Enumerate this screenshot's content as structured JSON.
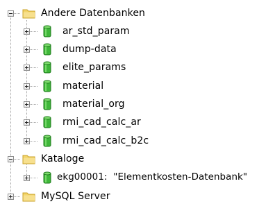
{
  "tree": {
    "groups": [
      {
        "label": "Andere Datenbanken",
        "expanded": true,
        "icon": "folder-icon",
        "children": [
          {
            "label": "ar_std_param",
            "icon": "database-icon"
          },
          {
            "label": "dump-data",
            "icon": "database-icon"
          },
          {
            "label": "elite_params",
            "icon": "database-icon"
          },
          {
            "label": "material",
            "icon": "database-icon"
          },
          {
            "label": "material_org",
            "icon": "database-icon"
          },
          {
            "label": "rmi_cad_calc_ar",
            "icon": "database-icon"
          },
          {
            "label": "rmi_cad_calc_b2c",
            "icon": "database-icon"
          }
        ]
      },
      {
        "label": "Kataloge",
        "expanded": true,
        "icon": "folder-icon",
        "children": [
          {
            "label": "ekg00001:  \"Elementkosten-Datenbank\"",
            "icon": "database-icon"
          }
        ]
      },
      {
        "label": "MySQL Server",
        "expanded": false,
        "icon": "folder-icon",
        "children": []
      }
    ]
  },
  "colors": {
    "folder": "#f2d46a",
    "folder_dark": "#c9a227",
    "database": "#3fb73a",
    "database_dark": "#1d7a1b",
    "tree_line": "#a0a0a0"
  }
}
